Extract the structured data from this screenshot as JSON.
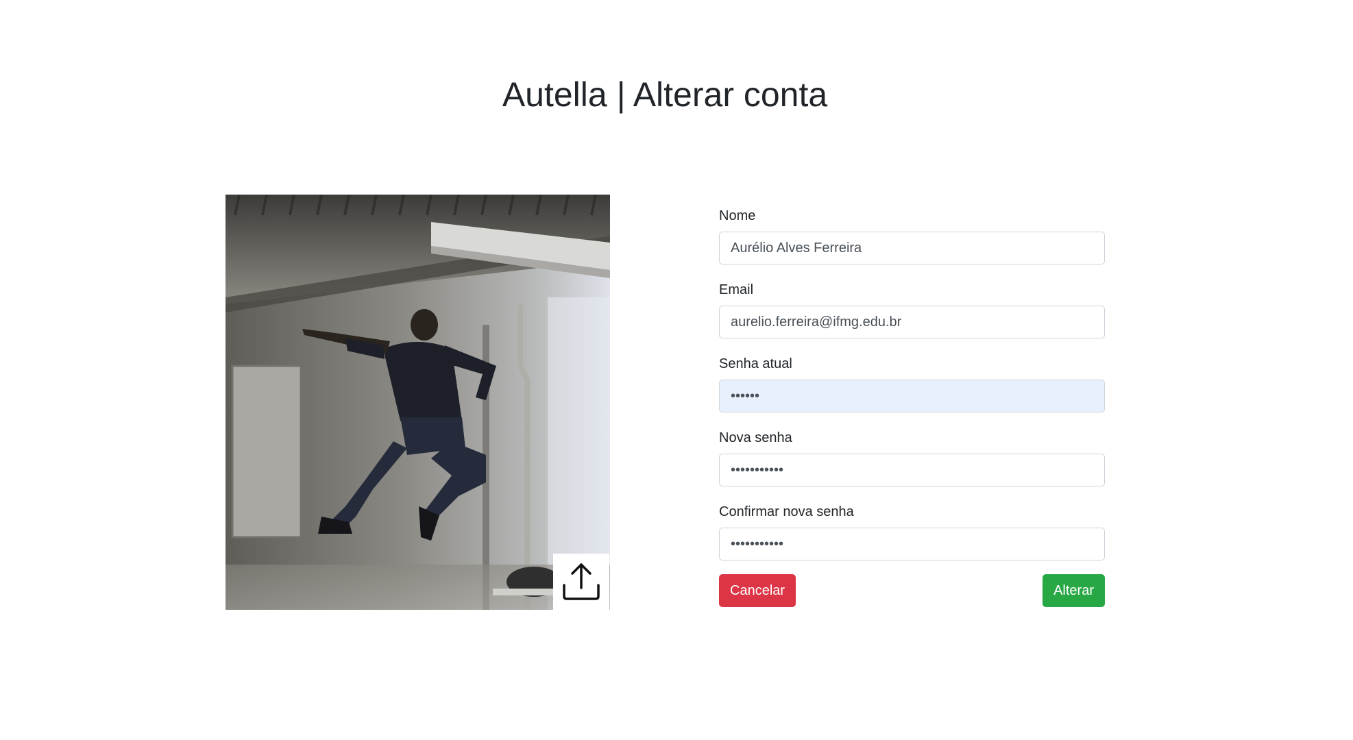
{
  "page": {
    "title": "Autella | Alterar conta"
  },
  "photo": {
    "upload_icon": "upload-icon"
  },
  "form": {
    "name": {
      "label": "Nome",
      "value": "Aurélio Alves Ferreira"
    },
    "email": {
      "label": "Email",
      "value": "aurelio.ferreira@ifmg.edu.br"
    },
    "current_password": {
      "label": "Senha atual",
      "value": "••••••"
    },
    "new_password": {
      "label": "Nova senha",
      "value": "•••••••••••"
    },
    "confirm_password": {
      "label": "Confirmar nova senha",
      "value": "•••••••••••"
    },
    "cancel_label": "Cancelar",
    "submit_label": "Alterar"
  },
  "colors": {
    "danger": "#dc3545",
    "success": "#28a745",
    "autofill": "#e8f0fe"
  }
}
